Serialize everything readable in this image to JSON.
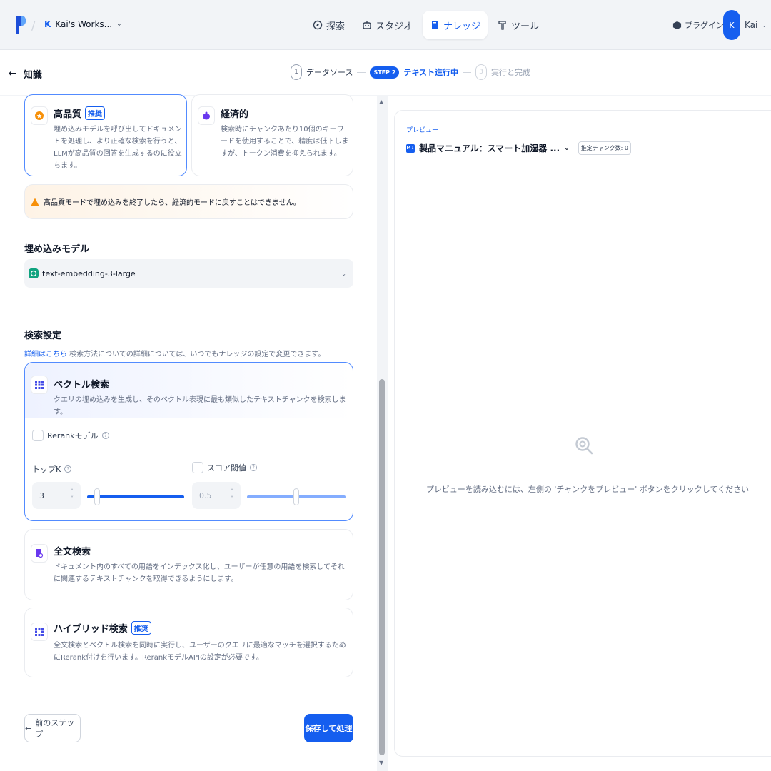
{
  "header": {
    "workspace_initial": "K",
    "workspace_name": "Kai's Works...",
    "nav": [
      {
        "label": "探索",
        "icon": "compass-icon"
      },
      {
        "label": "スタジオ",
        "icon": "robot-icon"
      },
      {
        "label": "ナレッジ",
        "icon": "book-icon"
      },
      {
        "label": "ツール",
        "icon": "hammer-icon"
      }
    ],
    "plugins_label": "プラグイン",
    "user_initial": "K",
    "user_name": "Kai"
  },
  "subheader": {
    "back_label": "知識",
    "steps": [
      {
        "num": "1",
        "label": "データソース"
      },
      {
        "num": "STEP 2",
        "label": "テキスト進行中"
      },
      {
        "num": "3",
        "label": "実行と完成"
      }
    ]
  },
  "index_mode": {
    "high_quality": {
      "title": "高品質",
      "badge": "推奨",
      "desc": "埋め込みモデルを呼び出してドキュメントを処理し、より正確な検索を行うと、LLMが高品質の回答を生成するのに役立ちます。"
    },
    "economy": {
      "title": "経済的",
      "desc": "検索時にチャンクあたり10個のキーワードを使用することで、精度は低下しますが、トークン消費を抑えられます。"
    },
    "warning": "高品質モードで埋め込みを終了したら、経済的モードに戻すことはできません。"
  },
  "embedding": {
    "title": "埋め込みモデル",
    "model": "text-embedding-3-large"
  },
  "search": {
    "title": "検索設定",
    "link": "詳細はこちら",
    "desc": "検索方法についての詳細については、いつでもナレッジの設定で変更できます。",
    "vector": {
      "title": "ベクトル検索",
      "desc": "クエリの埋め込みを生成し、そのベクトル表現に最も類似したテキストチャンクを検索します。",
      "rerank_label": "Rerankモデル",
      "topk_label": "トップK",
      "topk_value": "3",
      "topk_fraction": 0.1,
      "score_label": "スコア閾値",
      "score_value": "0.5",
      "score_fraction": 0.5
    },
    "fulltext": {
      "title": "全文検索",
      "desc": "ドキュメント内のすべての用語をインデックス化し、ユーザーが任意の用語を検索してそれに関連するテキストチャンクを取得できるようにします。"
    },
    "hybrid": {
      "title": "ハイブリッド検索",
      "badge": "推奨",
      "desc": "全文検索とベクトル検索を同時に実行し、ユーザーのクエリに最適なマッチを選択するためにRerank付けを行います。RerankモデルAPIの設定が必要です。"
    }
  },
  "actions": {
    "prev": "前のステップ",
    "save": "保存して処理"
  },
  "preview": {
    "label": "プレビュー",
    "doc_name": "製品マニュアル：スマート加湿器 ...",
    "chunk_badge": "推定チャンク数: 0",
    "empty": "プレビューを読み込むには、左側の 'チャンクをプレビュー' ボタンをクリックしてください"
  },
  "colors": {
    "accent": "#155eef",
    "warning": "#f79009"
  }
}
